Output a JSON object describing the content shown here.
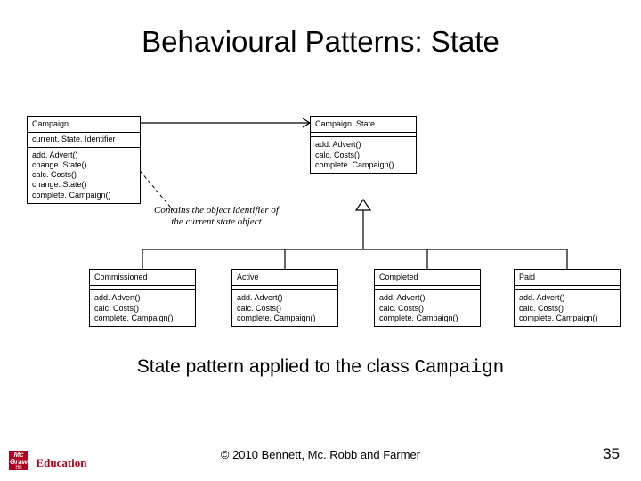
{
  "title": "Behavioural Patterns: State",
  "caption_prefix": "State pattern applied to the class ",
  "caption_class": "Campaign",
  "copyright": "© 2010 Bennett, Mc. Robb and Farmer",
  "page_number": "35",
  "logo": {
    "top": "Mc",
    "mid": "Graw",
    "bot": "Hill",
    "word": "Education"
  },
  "note_text": "Contains the object identifier of the current state object",
  "classes": {
    "campaign": {
      "name": "Campaign",
      "attrs": "current. State. Identifier",
      "ops": "add. Advert()\nchange. State()\ncalc. Costs()\nchange. State()\ncomplete. Campaign()"
    },
    "campaignState": {
      "name": "Campaign. State",
      "attrs": "",
      "ops": "add. Advert()\ncalc. Costs()\ncomplete. Campaign()"
    },
    "commissioned": {
      "name": "Commissioned",
      "attrs": "",
      "ops": "add. Advert()\ncalc. Costs()\ncomplete. Campaign()"
    },
    "active": {
      "name": "Active",
      "attrs": "",
      "ops": "add. Advert()\ncalc. Costs()\ncomplete. Campaign()"
    },
    "completed": {
      "name": "Completed",
      "attrs": "",
      "ops": "add. Advert()\ncalc. Costs()\ncomplete. Campaign()"
    },
    "paid": {
      "name": "Paid",
      "attrs": "",
      "ops": "add. Advert()\ncalc. Costs()\ncomplete. Campaign()"
    }
  }
}
